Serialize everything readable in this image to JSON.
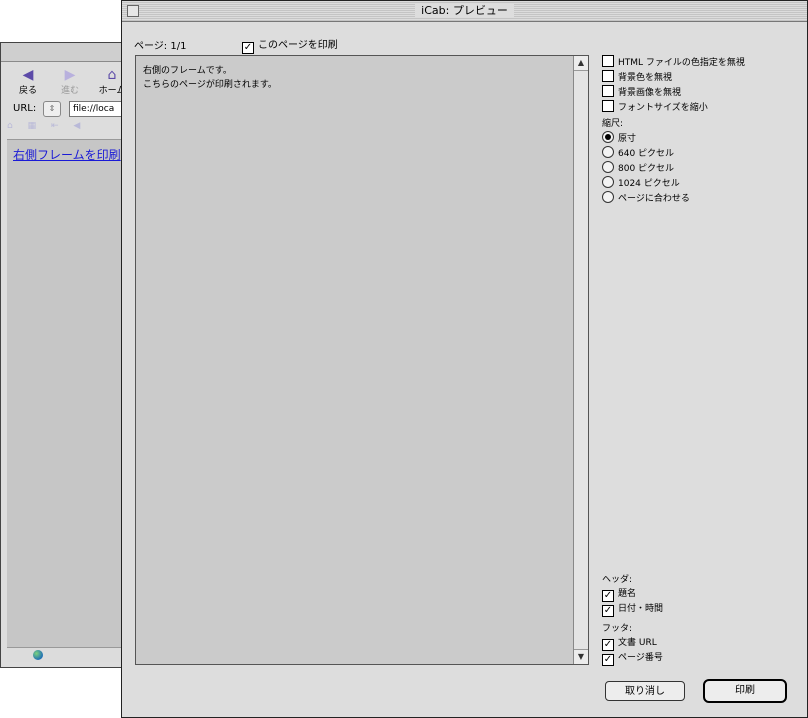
{
  "background_window": {
    "toolbar": [
      {
        "label": "戻る",
        "icon": "back-arrow-icon",
        "glyph": "◀"
      },
      {
        "label": "進む",
        "icon": "forward-arrow-icon",
        "glyph": "▶"
      },
      {
        "label": "ホーム",
        "icon": "home-icon",
        "glyph": "⌂"
      }
    ],
    "url_label": "URL:",
    "url_value": "file://loca",
    "link_text": "右側フレームを印刷"
  },
  "dialog": {
    "title": "iCab: プレビュー",
    "page_count": "ページ: 1/1",
    "print_this_page_label": "このページを印刷",
    "print_this_page_checked": true,
    "preview_text": "右側のフレームです。\nこちらのページが印刷されます。",
    "options": [
      {
        "label": "HTML ファイルの色指定を無視",
        "checked": false
      },
      {
        "label": "背景色を無視",
        "checked": false
      },
      {
        "label": "背景画像を無視",
        "checked": false
      },
      {
        "label": "フォントサイズを縮小",
        "checked": false
      }
    ],
    "scale_label": "縮尺:",
    "scale_options": [
      {
        "label": "原寸",
        "selected": true
      },
      {
        "label": "640 ピクセル",
        "selected": false
      },
      {
        "label": "800 ピクセル",
        "selected": false
      },
      {
        "label": "1024 ピクセル",
        "selected": false
      },
      {
        "label": "ページに合わせる",
        "selected": false
      }
    ],
    "header_label": "ヘッダ:",
    "header_options": [
      {
        "label": "題名",
        "checked": true
      },
      {
        "label": "日付・時間",
        "checked": true
      }
    ],
    "footer_label": "フッタ:",
    "footer_options": [
      {
        "label": "文書 URL",
        "checked": true
      },
      {
        "label": "ページ番号",
        "checked": true
      }
    ],
    "cancel_button": "取り消し",
    "print_button": "印刷"
  }
}
